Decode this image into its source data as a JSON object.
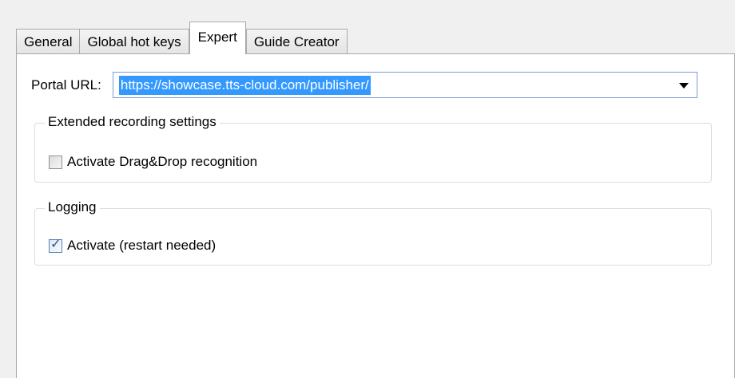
{
  "tabs": [
    {
      "label": "General",
      "active": false
    },
    {
      "label": "Global hot keys",
      "active": false
    },
    {
      "label": "Expert",
      "active": true
    },
    {
      "label": "Guide Creator",
      "active": false
    }
  ],
  "portal": {
    "label": "Portal URL:",
    "value": "https://showcase.tts-cloud.com/publisher/"
  },
  "extended_recording": {
    "title": "Extended recording settings",
    "drag_drop": {
      "label": "Activate Drag&Drop recognition",
      "checked": false
    }
  },
  "logging": {
    "title": "Logging",
    "activate": {
      "label": "Activate (restart needed)",
      "checked": true,
      "mark": "✓"
    }
  },
  "colors": {
    "selection": "#3399ff",
    "border": "#a9a9a9",
    "group_border": "#d5dfe5"
  }
}
